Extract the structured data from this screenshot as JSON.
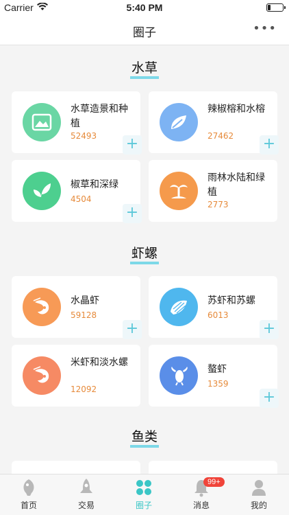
{
  "status_bar": {
    "carrier": "Carrier",
    "time": "5:40 PM"
  },
  "nav": {
    "title": "圈子",
    "more_label": "•••"
  },
  "sections": [
    {
      "title": "水草",
      "cards": [
        {
          "name": "水草造景和种植",
          "count": "52493",
          "icon": "landscape-icon",
          "color": "#6ad6a4"
        },
        {
          "name": "辣椒榕和水榕",
          "count": "27462",
          "icon": "leaves-icon",
          "color": "#7db3f3"
        },
        {
          "name": "椒草和深绿",
          "count": "4504",
          "icon": "sprout-icon",
          "color": "#4dcf8f"
        },
        {
          "name": "雨林水陆和绿植",
          "count": "2773",
          "icon": "palm-tree-icon",
          "color": "#f59a4c"
        }
      ]
    },
    {
      "title": "虾螺",
      "cards": [
        {
          "name": "水晶虾",
          "count": "59128",
          "icon": "shrimp-icon",
          "color": "#f79a56"
        },
        {
          "name": "苏虾和苏螺",
          "count": "6013",
          "icon": "snail-shell-icon",
          "color": "#4fb7ee"
        },
        {
          "name": "米虾和淡水螺",
          "count": "12092",
          "icon": "shrimp-icon",
          "color": "#f68a64"
        },
        {
          "name": "螯虾",
          "count": "1359",
          "icon": "crayfish-icon",
          "color": "#5a8ee8"
        }
      ]
    },
    {
      "title": "鱼类",
      "cards": []
    }
  ],
  "tabs": [
    {
      "label": "首页",
      "icon": "fish-icon"
    },
    {
      "label": "交易",
      "icon": "rocket-icon"
    },
    {
      "label": "圈子",
      "icon": "clover-icon",
      "active": true
    },
    {
      "label": "消息",
      "icon": "bell-icon",
      "badge": "99+"
    },
    {
      "label": "我的",
      "icon": "person-icon"
    }
  ]
}
